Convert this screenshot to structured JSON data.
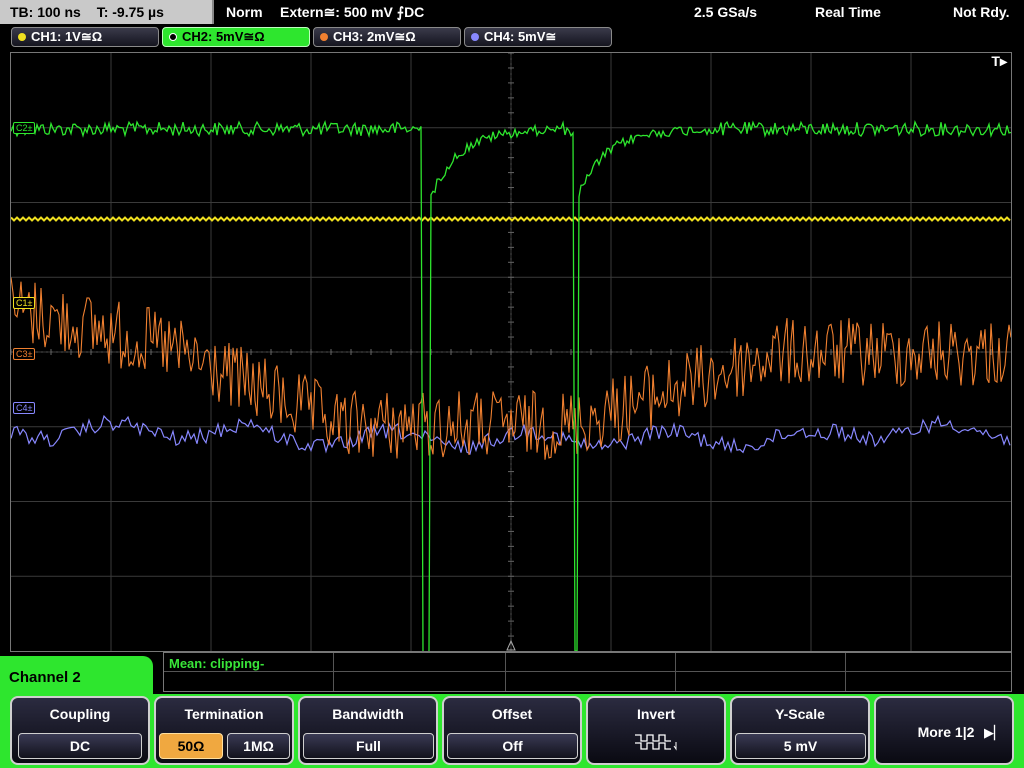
{
  "status": {
    "timebase": "TB: 100 ns",
    "trigger_time": "T: -9.75 µs",
    "mode": "Norm",
    "trigger": "Extern≅: 500 mV ⨍DC",
    "sample_rate": "2.5 GSa/s",
    "acquisition": "Real Time",
    "state": "Not Rdy."
  },
  "channels": [
    {
      "label": "CH1: 1V≅Ω",
      "color": "#f0e020"
    },
    {
      "label": "CH2: 5mV≅Ω",
      "color": "#2ee62e"
    },
    {
      "label": "CH3: 2mV≅Ω",
      "color": "#f08030"
    },
    {
      "label": "CH4: 5mV≅",
      "color": "#8888ff"
    }
  ],
  "screen": {
    "trigger_marker": "T▸",
    "markers": [
      {
        "label": "C2±",
        "color": "#2ee62e"
      },
      {
        "label": "C1±",
        "color": "#f0e020"
      },
      {
        "label": "C3±",
        "color": "#f08030"
      },
      {
        "label": "C4±",
        "color": "#8888ff"
      }
    ]
  },
  "measurement": {
    "text": "Mean: clipping-"
  },
  "channel_menu": {
    "title": "Channel 2"
  },
  "softkeys": {
    "coupling": {
      "title": "Coupling",
      "value": "DC"
    },
    "termination": {
      "title": "Termination",
      "option_a": "50Ω",
      "option_b": "1MΩ",
      "selected": "50Ω"
    },
    "bandwidth": {
      "title": "Bandwidth",
      "value": "Full"
    },
    "offset": {
      "title": "Offset",
      "value": "Off"
    },
    "invert": {
      "title": "Invert",
      "icon": "invert-waveform-icon"
    },
    "yscale": {
      "title": "Y-Scale",
      "value": "5 mV"
    },
    "more": {
      "label": "More 1|2",
      "icon": "next-page-arrow-icon"
    }
  },
  "colors": {
    "accent": "#2ee62e",
    "selected": "#f0a840",
    "ch1": "#f0e020",
    "ch2": "#2ee62e",
    "ch3": "#f08030",
    "ch4": "#8888ff"
  }
}
